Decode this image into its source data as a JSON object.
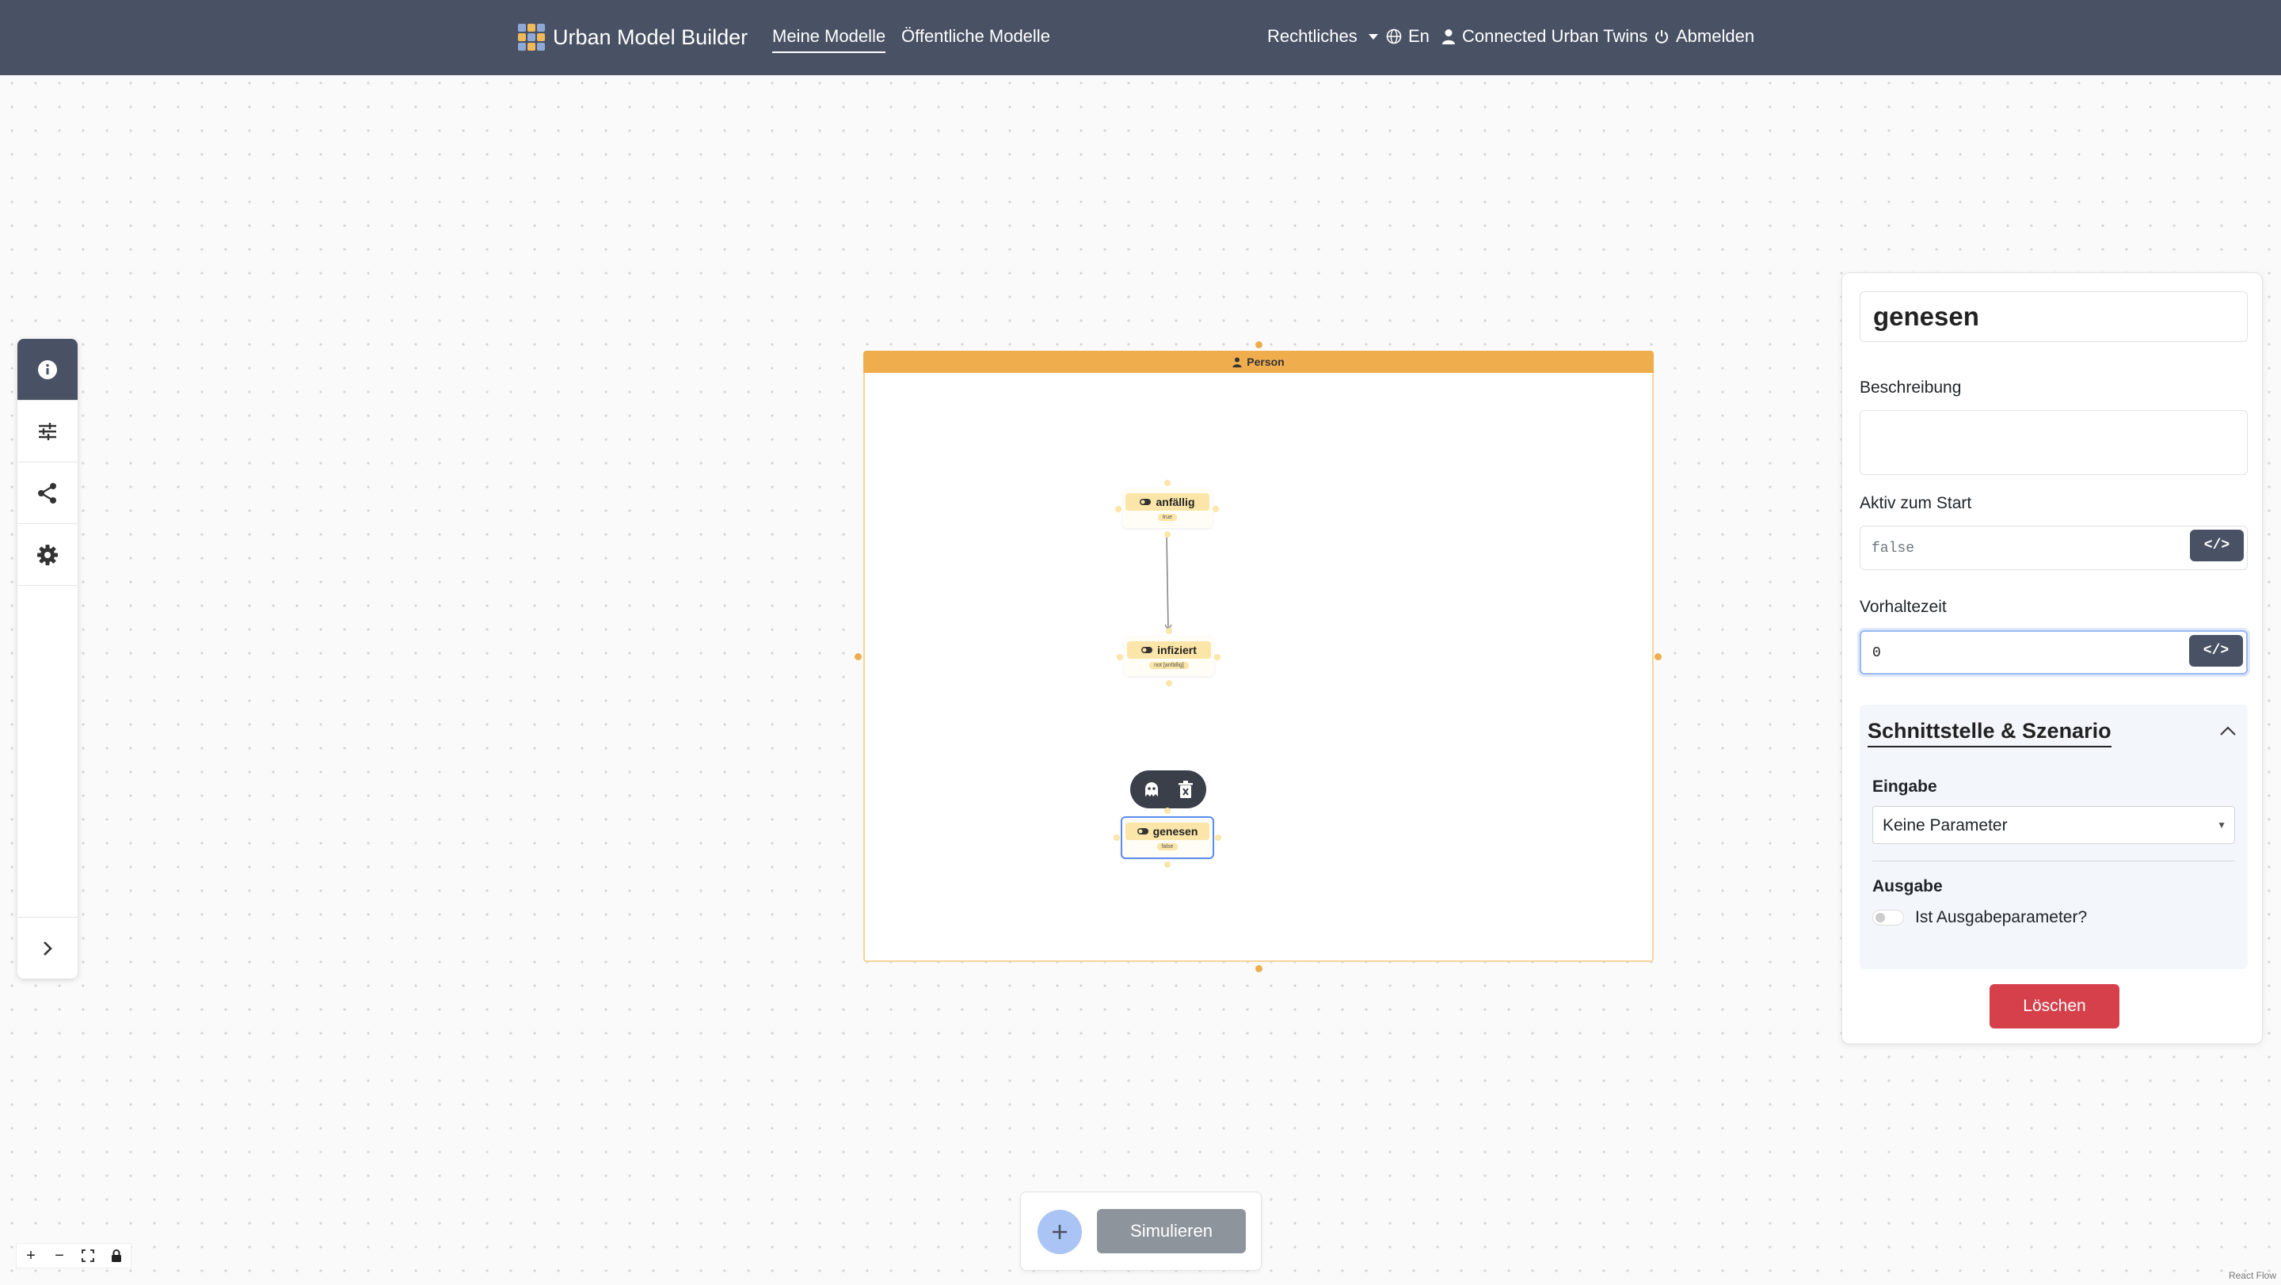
{
  "navbar": {
    "brand": "Urban Model Builder",
    "links": [
      "Meine Modelle",
      "Öffentliche Modelle"
    ],
    "legal": "Rechtliches",
    "language": "En",
    "user": "Connected Urban Twins",
    "logout": "Abmelden"
  },
  "sidebar": {
    "items": [
      "info-icon",
      "sliders-icon",
      "share-icon",
      "gear-icon"
    ],
    "expand": "chevron-right-icon"
  },
  "canvas": {
    "group_title": "Person",
    "nodes": [
      {
        "label": "anfällig",
        "sub": "true"
      },
      {
        "label": "infiziert",
        "sub": "not [anfällig]"
      },
      {
        "label": "genesen",
        "sub": "false"
      }
    ]
  },
  "panel": {
    "name": "genesen",
    "description_label": "Beschreibung",
    "description_value": "",
    "active_label": "Aktiv zum Start",
    "active_value": "false",
    "lead_label": "Vorhaltezeit",
    "lead_value": "0",
    "code_btn": "</>",
    "section_title": "Schnittstelle & Szenario",
    "input_label": "Eingabe",
    "input_value": "Keine Parameter",
    "output_label": "Ausgabe",
    "output_toggle_label": "Ist Ausgabeparameter?",
    "delete": "Löschen"
  },
  "bottom": {
    "simulate": "Simulieren"
  },
  "flow_controls": [
    "+",
    "−",
    "⛶",
    "🔒"
  ],
  "attribution": "React Flow"
}
